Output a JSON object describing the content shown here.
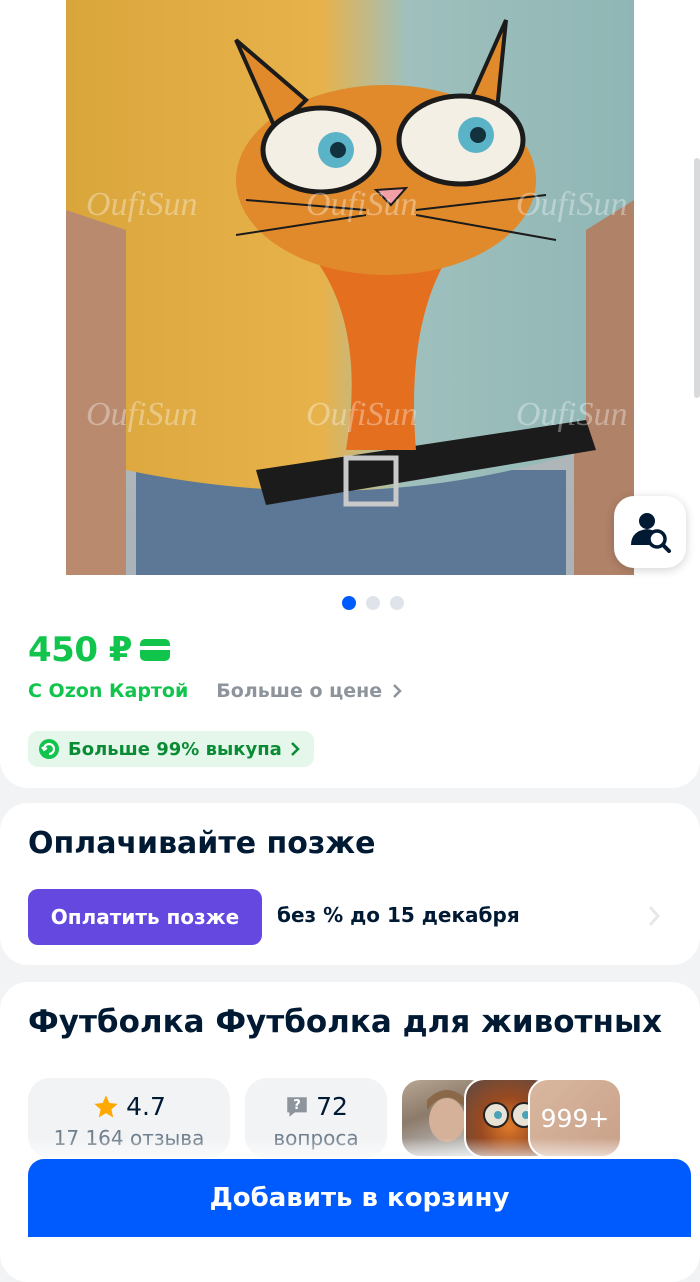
{
  "gallery": {
    "watermark": "OufiSun",
    "total_slides": 3,
    "active_slide": 1
  },
  "price": {
    "amount": "450 ₽",
    "ozon_card_label": "С Ozon Картой",
    "more_about_price": "Больше о цене",
    "buyout_badge": "Больше 99% выкупа"
  },
  "pay_later": {
    "title": "Оплачивайте позже",
    "button": "Оплатить позже",
    "terms": "без % до 15 декабря"
  },
  "product": {
    "title": "Футболка Футболка для животных",
    "rating": "4.7",
    "reviews": "17 164 отзыва",
    "questions_count": "72",
    "questions_label": "вопроса",
    "media_count": "999+"
  },
  "cart": {
    "button": "Добавить в корзину"
  },
  "colors": {
    "accent_blue": "#005bff",
    "price_green": "#10c44c",
    "pay_purple": "#6448e0"
  }
}
